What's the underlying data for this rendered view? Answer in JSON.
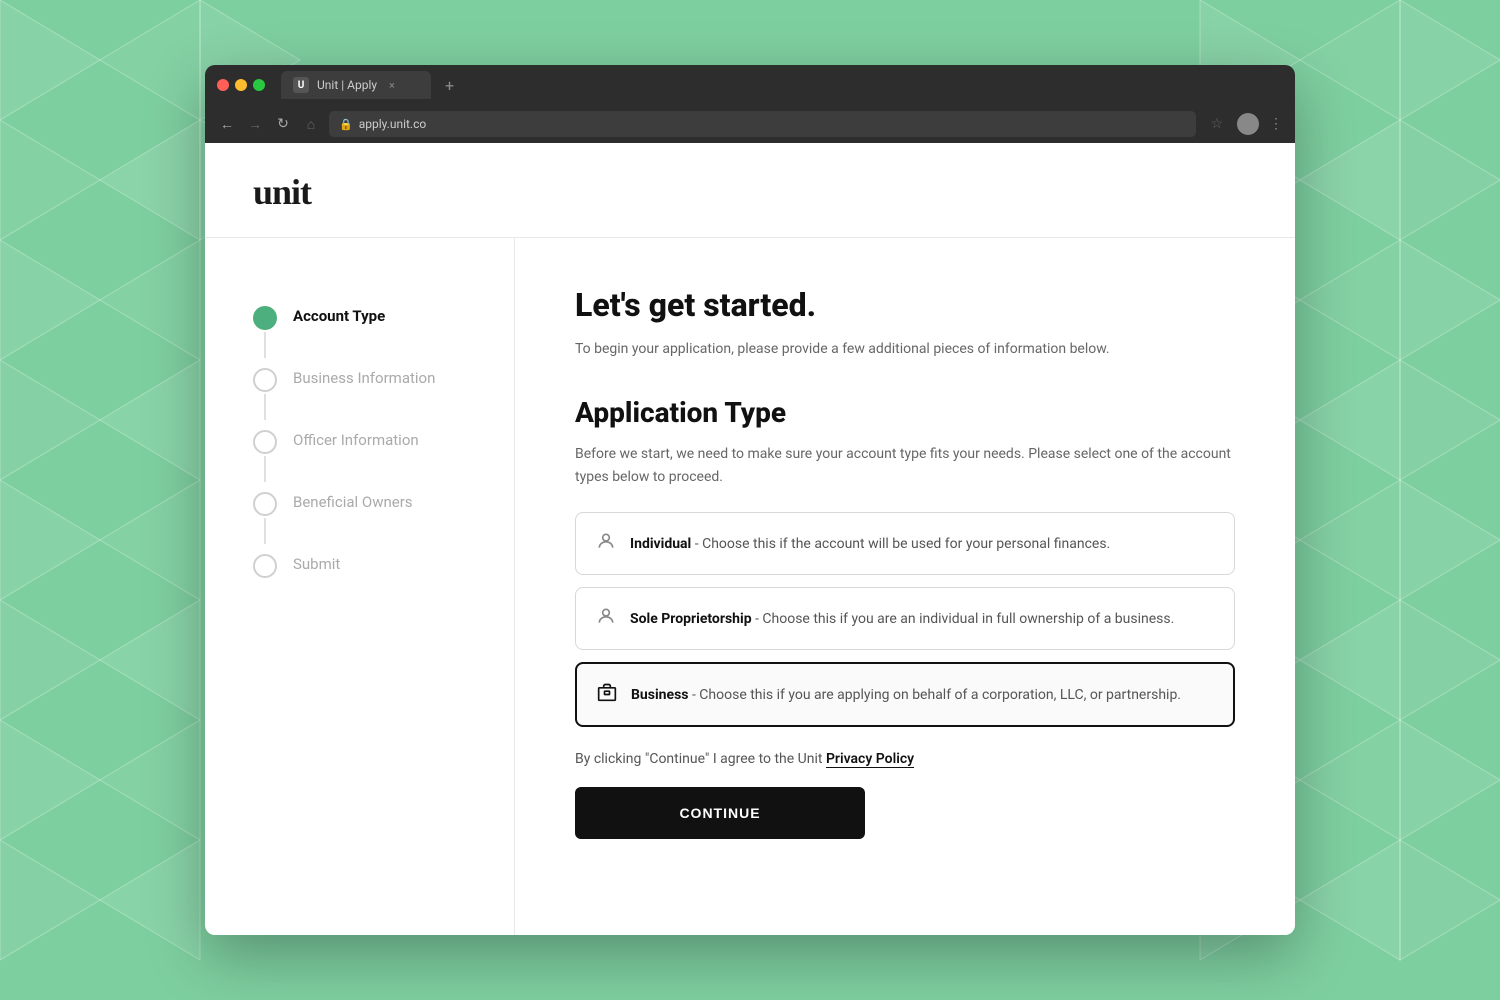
{
  "browser": {
    "tab_favicon": "U",
    "tab_title": "Unit | Apply",
    "tab_close": "×",
    "tab_add": "+",
    "nav_back": "←",
    "nav_forward": "→",
    "nav_refresh": "↻",
    "nav_home": "⌂",
    "lock_icon": "🔒",
    "address": "apply.unit.co",
    "star": "☆",
    "menu": "⋮"
  },
  "logo": "unit",
  "sidebar": {
    "steps": [
      {
        "id": "account-type",
        "label": "Account Type",
        "state": "active"
      },
      {
        "id": "business-info",
        "label": "Business Information",
        "state": "inactive"
      },
      {
        "id": "officer-info",
        "label": "Officer Information",
        "state": "inactive"
      },
      {
        "id": "beneficial-owners",
        "label": "Beneficial Owners",
        "state": "inactive"
      },
      {
        "id": "submit",
        "label": "Submit",
        "state": "inactive"
      }
    ]
  },
  "form": {
    "heading": "Let's get started.",
    "description": "To begin your application, please provide a few additional pieces of information below.",
    "application_type_heading": "Application Type",
    "application_type_desc": "Before we start, we need to make sure your account type fits your needs. Please select one of the account types below to proceed.",
    "options": [
      {
        "id": "individual",
        "label": "Individual",
        "separator": " - ",
        "description": "Choose this if the account will be used for your personal finances.",
        "selected": false,
        "icon": "person"
      },
      {
        "id": "sole-proprietorship",
        "label": "Sole Proprietorship",
        "separator": " - ",
        "description": "Choose this if you are an individual in full ownership of a business.",
        "selected": false,
        "icon": "person"
      },
      {
        "id": "business",
        "label": "Business",
        "separator": " - ",
        "description": "Choose this if you are applying on behalf of a corporation, LLC, or partnership.",
        "selected": true,
        "icon": "building"
      }
    ],
    "privacy_prefix": "By clicking \"Continue\" I agree to the Unit ",
    "privacy_link": "Privacy Policy",
    "continue_label": "CONTINUE"
  }
}
